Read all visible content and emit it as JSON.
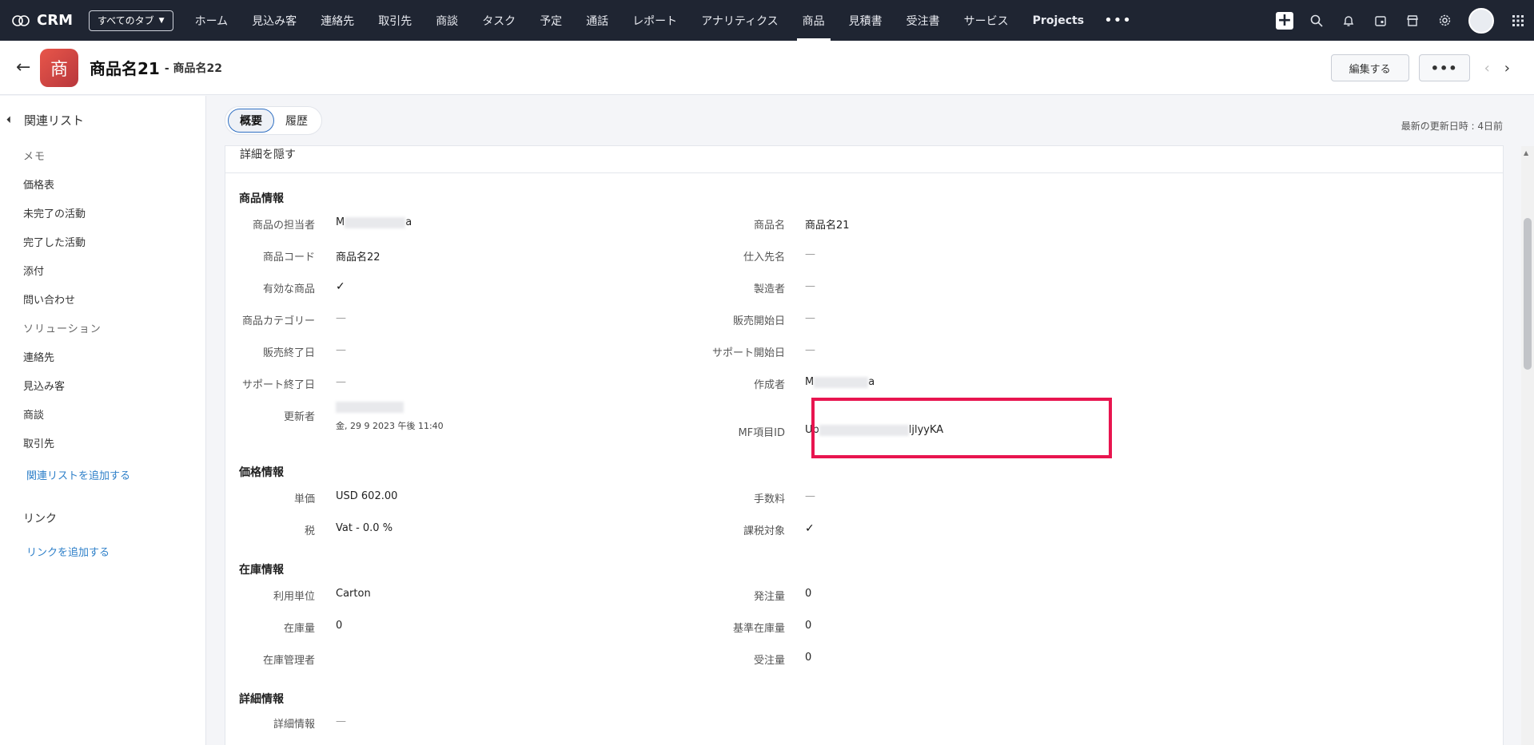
{
  "nav": {
    "brand": "CRM",
    "all_tabs_label": "すべてのタブ",
    "tabs": [
      {
        "label": "ホーム",
        "active": false
      },
      {
        "label": "見込み客",
        "active": false
      },
      {
        "label": "連絡先",
        "active": false
      },
      {
        "label": "取引先",
        "active": false
      },
      {
        "label": "商談",
        "active": false
      },
      {
        "label": "タスク",
        "active": false
      },
      {
        "label": "予定",
        "active": false
      },
      {
        "label": "通話",
        "active": false
      },
      {
        "label": "レポート",
        "active": false
      },
      {
        "label": "アナリティクス",
        "active": false
      },
      {
        "label": "商品",
        "active": true
      },
      {
        "label": "見積書",
        "active": false
      },
      {
        "label": "受注書",
        "active": false
      },
      {
        "label": "サービス",
        "active": false
      },
      {
        "label": "Projects",
        "active": false
      }
    ],
    "more_label": "•••",
    "icons": [
      "plus-icon",
      "search-icon",
      "bell-icon",
      "calendar-icon",
      "marketplace-icon",
      "gear-icon",
      "avatar",
      "apps-grid-icon"
    ]
  },
  "record": {
    "icon_char": "商",
    "title": "商品名21",
    "subtitle": "- 商品名22",
    "edit_label": "編集する",
    "more_label": "•••",
    "prev_label": "‹",
    "next_label": "›"
  },
  "sidebar": {
    "header": "関連リスト",
    "items": [
      "メモ",
      "価格表",
      "未完了の活動",
      "完了した活動",
      "添付",
      "問い合わせ",
      "ソリューション",
      "連絡先",
      "見込み客",
      "商談",
      "取引先"
    ],
    "add_related": "関連リストを追加する",
    "links_header": "リンク",
    "add_link": "リンクを追加する"
  },
  "tabs": {
    "overview": "概要",
    "history": "履歴"
  },
  "last_modified": "最新の更新日時 : 4日前",
  "details": {
    "hide_label": "詳細を隠す",
    "sections": {
      "product_info": "商品情報",
      "price_info": "価格情報",
      "stock_info": "在庫情報",
      "detail_info": "詳細情報"
    },
    "fields": {
      "owner_label": "商品の担当者",
      "owner_value_start": "M",
      "owner_value_end": "a",
      "name_label": "商品名",
      "name_value": "商品名21",
      "code_label": "商品コード",
      "code_value": "商品名22",
      "vendor_label": "仕入先名",
      "vendor_value": "—",
      "active_label": "有効な商品",
      "active_value": "✓",
      "manufacturer_label": "製造者",
      "manufacturer_value": "—",
      "category_label": "商品カテゴリー",
      "category_value": "—",
      "sales_start_label": "販売開始日",
      "sales_start_value": "—",
      "sales_end_label": "販売終了日",
      "sales_end_value": "—",
      "support_start_label": "サポート開始日",
      "support_start_value": "—",
      "support_end_label": "サポート終了日",
      "support_end_value": "—",
      "creator_label": "作成者",
      "creator_value_start": "M",
      "creator_value_end": "a",
      "modifier_label": "更新者",
      "modifier_date": "金, 29 9 2023 午後 11:40",
      "mf_id_label": "MF項目ID",
      "mf_id_start": "Up",
      "mf_id_end": "ljlyyKA",
      "unit_price_label": "単価",
      "unit_price_value": "USD 602.00",
      "commission_label": "手数料",
      "commission_value": "—",
      "tax_label": "税",
      "tax_value": "Vat - 0.0 %",
      "taxable_label": "課税対象",
      "taxable_value": "✓",
      "usage_unit_label": "利用単位",
      "usage_unit_value": "Carton",
      "order_qty_label": "発注量",
      "order_qty_value": "0",
      "stock_qty_label": "在庫量",
      "stock_qty_value": "0",
      "reorder_label": "基準在庫量",
      "reorder_value": "0",
      "handler_label": "在庫管理者",
      "demand_label": "受注量",
      "demand_value": "0",
      "description_label": "詳細情報",
      "description_value": "—"
    }
  }
}
